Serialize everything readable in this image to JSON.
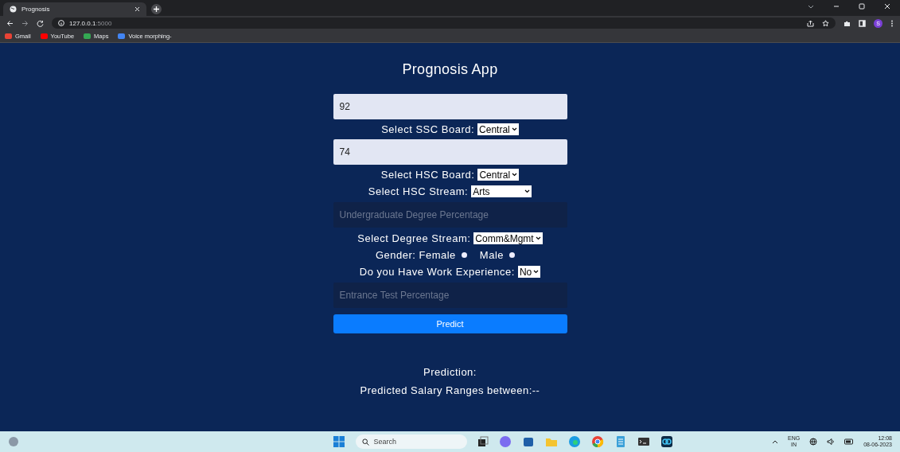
{
  "browser": {
    "tab_title": "Prognosis",
    "url_host": "127.0.0.1",
    "url_port": ":5000",
    "profile_initial": "S",
    "bookmarks": [
      {
        "label": "Gmail",
        "color": "#ea4335"
      },
      {
        "label": "YouTube",
        "color": "#ff0000"
      },
      {
        "label": "Maps",
        "color": "#34a853"
      },
      {
        "label": "Voice morphing-",
        "color": "#4285f4"
      }
    ]
  },
  "app": {
    "title": "Prognosis App",
    "form": [
      {
        "kind": "input",
        "value": "92"
      },
      {
        "kind": "select",
        "label": "Select SSC Board:",
        "value": "Central"
      },
      {
        "kind": "input",
        "value": "74"
      },
      {
        "kind": "select",
        "label": "Select HSC Board:",
        "value": "Central"
      },
      {
        "kind": "select",
        "label": "Select HSC Stream:",
        "value": "Arts"
      },
      {
        "kind": "input",
        "placeholder": "Undergraduate Degree Percentage"
      },
      {
        "kind": "select",
        "label": "Select Degree Stream:",
        "value": "Comm&Mgmt"
      },
      {
        "kind": "radio",
        "label": "Gender:",
        "options": [
          {
            "label": "Female",
            "selected": false
          },
          {
            "label": "Male",
            "selected": false
          }
        ]
      },
      {
        "kind": "select",
        "label": "Do you Have Work Experience:",
        "value": "No"
      },
      {
        "kind": "input",
        "placeholder": "Entrance Test Percentage"
      },
      {
        "kind": "button",
        "label": "Predict"
      }
    ],
    "results": [
      "Prediction:",
      "Predicted Salary Ranges between:--"
    ]
  },
  "taskbar": {
    "search_placeholder": "Search",
    "language": "ENG",
    "region": "IN",
    "time": "12:08",
    "date": "08-06-2023"
  }
}
